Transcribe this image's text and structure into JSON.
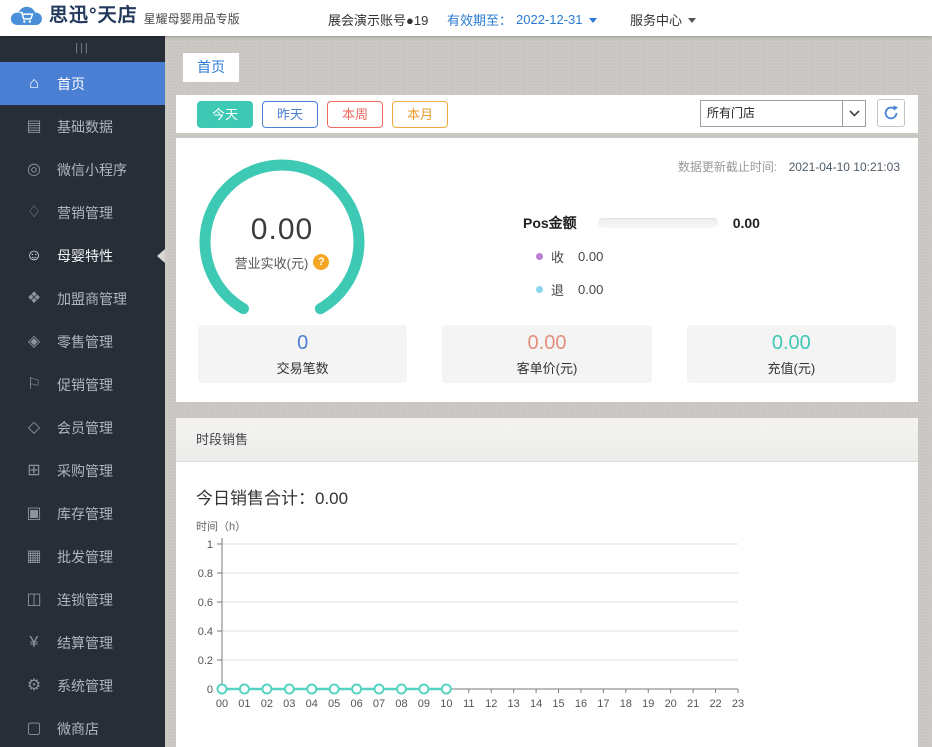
{
  "header": {
    "brand": "思迅°天店",
    "brand_subtitle": "星耀母婴用品专版",
    "account": "展会演示账号●19",
    "validity_label": "有效期至：",
    "validity_date": "2022-12-31",
    "service_center": "服务中心"
  },
  "sidebar": {
    "collapse_glyph": "|||",
    "items": [
      {
        "label": "首页",
        "glyph": "⌂"
      },
      {
        "label": "基础数据",
        "glyph": "▤"
      },
      {
        "label": "微信小程序",
        "glyph": "◎"
      },
      {
        "label": "营销管理",
        "glyph": "♢"
      },
      {
        "label": "母婴特性",
        "glyph": "☺"
      },
      {
        "label": "加盟商管理",
        "glyph": "❖"
      },
      {
        "label": "零售管理",
        "glyph": "◈"
      },
      {
        "label": "促销管理",
        "glyph": "⚐"
      },
      {
        "label": "会员管理",
        "glyph": "◇"
      },
      {
        "label": "采购管理",
        "glyph": "⊞"
      },
      {
        "label": "库存管理",
        "glyph": "▣"
      },
      {
        "label": "批发管理",
        "glyph": "▦"
      },
      {
        "label": "连锁管理",
        "glyph": "◫"
      },
      {
        "label": "结算管理",
        "glyph": "¥"
      },
      {
        "label": "系统管理",
        "glyph": "⚙"
      },
      {
        "label": "微商店",
        "glyph": "▢"
      }
    ]
  },
  "tabs": {
    "home": "首页"
  },
  "toolbar": {
    "filters": [
      {
        "label": "今天",
        "style": "teal-solid"
      },
      {
        "label": "昨天",
        "style": "blue"
      },
      {
        "label": "本周",
        "style": "red"
      },
      {
        "label": "本月",
        "style": "orange"
      }
    ],
    "store_select_value": "所有门店"
  },
  "overview": {
    "update_time_label": "数据更新截止时间:",
    "update_time_value": "2021-04-10 10:21:03",
    "gauge": {
      "value": "0.00",
      "label": "营业实收(元)",
      "help_glyph": "?"
    },
    "pos": {
      "title": "Pos金额",
      "total": "0.00",
      "rows": [
        {
          "label": "收",
          "value": "0.00",
          "dot_color": "#b77fd2"
        },
        {
          "label": "退",
          "value": "0.00",
          "dot_color": "#8ad6f0"
        }
      ]
    },
    "cards": [
      {
        "value": "0",
        "label": "交易笔数",
        "color": "#4a7fd4"
      },
      {
        "value": "0.00",
        "label": "客单价(元)",
        "color": "#e2907e"
      },
      {
        "value": "0.00",
        "label": "充值(元)",
        "color": "#3fc8b4"
      }
    ]
  },
  "sales_section": {
    "title": "时段销售",
    "summary": "今日销售合计：0.00",
    "axis_label": "时间（h）"
  },
  "chart_data": {
    "type": "line",
    "title": "时段销售",
    "x": [
      "00",
      "01",
      "02",
      "03",
      "04",
      "05",
      "06",
      "07",
      "08",
      "09",
      "10",
      "11",
      "12",
      "13",
      "14",
      "15",
      "16",
      "17",
      "18",
      "19",
      "20",
      "21",
      "22",
      "23"
    ],
    "series": [
      {
        "name": "今日销售",
        "values": [
          0,
          0,
          0,
          0,
          0,
          0,
          0,
          0,
          0,
          0,
          0
        ]
      }
    ],
    "xlabel": "时间（h）",
    "ylabel": "",
    "ylim": [
      0,
      1
    ],
    "yticks": [
      0,
      0.2,
      0.4,
      0.6,
      0.8,
      1
    ],
    "grid": true,
    "legend": false,
    "line_color": "#57d3c2",
    "marker": "hollow-circle"
  },
  "colors": {
    "accent_teal": "#3ec9b5",
    "accent_blue": "#4a7fd4",
    "accent_red": "#ef6a5f",
    "accent_orange": "#f0ab3c",
    "sidebar_bg": "#272e37"
  }
}
